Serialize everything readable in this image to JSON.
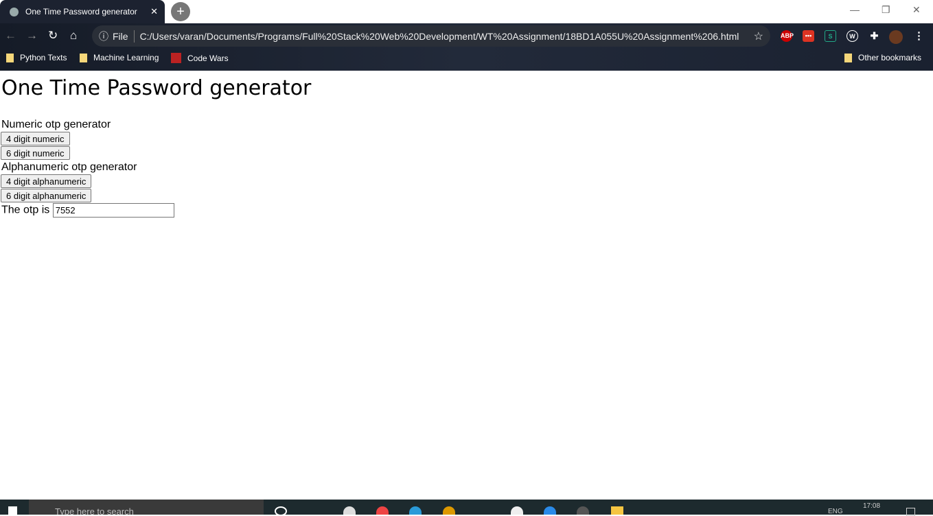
{
  "browser": {
    "tab_title": "One Time Password generator",
    "url_scheme": "File",
    "url": "C:/Users/varan/Documents/Programs/Full%20Stack%20Web%20Development/WT%20Assignment/18BD1A055U%20Assignment%206.html",
    "bookmarks": [
      "Python Texts",
      "Machine Learning",
      "Code Wars"
    ],
    "other_bookmarks": "Other bookmarks",
    "ext_abp": "ABP"
  },
  "page": {
    "title": "One Time Password generator",
    "numeric_label": "Numeric otp generator",
    "btn_4num": "4 digit numeric",
    "btn_6num": "6 digit numeric",
    "alpha_label": "Alphanumeric otp generator",
    "btn_4alpha": "4 digit alphanumeric",
    "btn_6alpha": "6 digit alphanumeric",
    "otp_label": "The otp is",
    "otp_value": "7552"
  },
  "taskbar": {
    "search_placeholder": "Type here to search",
    "lang": "ENG",
    "time": "17:08"
  }
}
